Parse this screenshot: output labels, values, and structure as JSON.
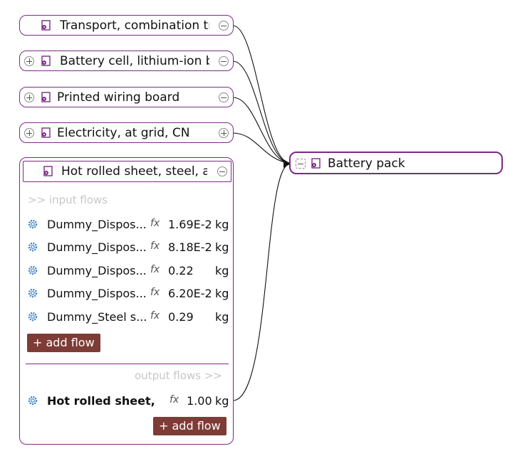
{
  "nodes": [
    {
      "title": "Transport, combination tr...",
      "toggle": "minus",
      "left_toggle": false
    },
    {
      "title": "Battery cell, lithium-ion b...",
      "toggle": "minus",
      "left_toggle": true
    },
    {
      "title": "Printed wiring board",
      "toggle": "minus",
      "left_toggle": true
    },
    {
      "title": "Electricity, at grid, CN",
      "toggle": "plus",
      "left_toggle": true
    }
  ],
  "expanded": {
    "title": "Hot rolled sheet, steel, at...",
    "input_label": ">> input flows",
    "output_label": "output flows >>",
    "inputs": [
      {
        "name": "Dummy_Dispos...",
        "amount": "1.69E-2",
        "unit": "kg"
      },
      {
        "name": "Dummy_Dispos...",
        "amount": "8.18E-2",
        "unit": "kg"
      },
      {
        "name": "Dummy_Dispos...",
        "amount": "0.22",
        "unit": "kg"
      },
      {
        "name": "Dummy_Dispos...",
        "amount": "6.20E-2",
        "unit": "kg"
      },
      {
        "name": "Dummy_Steel s...",
        "amount": "0.29",
        "unit": "kg"
      }
    ],
    "output": {
      "name": "Hot rolled sheet, ...",
      "amount": "1.00",
      "unit": "kg"
    },
    "add_flow_label": "+ add flow",
    "fx_symbol": "fx"
  },
  "target": {
    "title": "Battery pack"
  },
  "colors": {
    "border": "#7b2b86",
    "button": "#7d3c35",
    "icon": "#7b2b86",
    "gear": "#3b7fc4"
  }
}
